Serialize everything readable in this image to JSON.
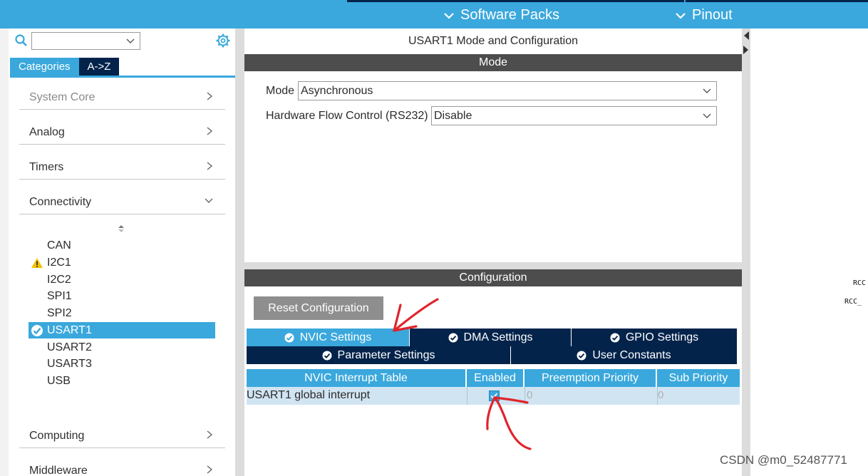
{
  "topbar": {
    "software_packs": "Software Packs",
    "pinout": "Pinout"
  },
  "sidebar": {
    "tab_categories": "Categories",
    "tab_az": "A->Z",
    "categories": [
      {
        "label": "System Core",
        "expanded": false,
        "dim": true
      },
      {
        "label": "Analog",
        "expanded": false
      },
      {
        "label": "Timers",
        "expanded": false
      },
      {
        "label": "Connectivity",
        "expanded": true
      },
      {
        "label": "Computing",
        "expanded": false
      },
      {
        "label": "Middleware",
        "expanded": false
      }
    ],
    "peripherals": [
      {
        "label": "CAN",
        "status": "none"
      },
      {
        "label": "I2C1",
        "status": "warning"
      },
      {
        "label": "I2C2",
        "status": "none"
      },
      {
        "label": "SPI1",
        "status": "none"
      },
      {
        "label": "SPI2",
        "status": "none"
      },
      {
        "label": "USART1",
        "status": "ok",
        "selected": true
      },
      {
        "label": "USART2",
        "status": "none"
      },
      {
        "label": "USART3",
        "status": "none"
      },
      {
        "label": "USB",
        "status": "none"
      }
    ]
  },
  "mode_panel": {
    "title": "USART1 Mode and Configuration",
    "section": "Mode",
    "mode_label": "Mode",
    "mode_value": "Asynchronous",
    "flow_label": "Hardware Flow Control (RS232)",
    "flow_value": "Disable"
  },
  "config_panel": {
    "section": "Configuration",
    "reset_button": "Reset Configuration",
    "tabs_row1": [
      "NVIC Settings",
      "DMA Settings",
      "GPIO Settings"
    ],
    "tabs_row2": [
      "Parameter Settings",
      "User Constants"
    ],
    "active_tab": "NVIC Settings",
    "nvic_table": {
      "headers": [
        "NVIC Interrupt Table",
        "Enabled",
        "Preemption Priority",
        "Sub Priority"
      ],
      "rows": [
        {
          "name": "USART1 global interrupt",
          "enabled": true,
          "preemption": "0",
          "sub": "0"
        }
      ]
    }
  },
  "right_pane": {
    "labels": [
      "RCC",
      "RCC_"
    ]
  },
  "watermark": "CSDN @m0_52487771",
  "colors": {
    "accent": "#3aa8dc",
    "navy": "#03234b",
    "section_bar": "#4d4d4d",
    "annotation": "#e0242b"
  }
}
